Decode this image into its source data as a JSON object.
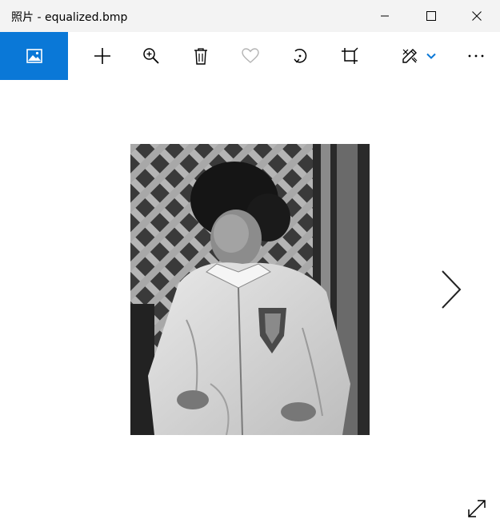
{
  "window": {
    "title": "照片 - equalized.bmp",
    "controls": [
      {
        "name": "minimize-icon"
      },
      {
        "name": "maximize-icon"
      },
      {
        "name": "close-icon"
      }
    ]
  },
  "toolbar": {
    "items": [
      {
        "name": "photo-icon",
        "active": true
      },
      {
        "name": "add-icon"
      },
      {
        "name": "zoom-in-icon"
      },
      {
        "name": "delete-icon"
      },
      {
        "name": "favorite-heart-icon",
        "disabled": true
      },
      {
        "name": "rotate-icon"
      },
      {
        "name": "crop-icon"
      },
      {
        "name": "edit-draw-icon"
      },
      {
        "name": "chevron-down-icon"
      },
      {
        "name": "more-icon"
      }
    ],
    "accent_color": "#0a78d7"
  },
  "viewer": {
    "image_subject": "grayscale photo of a child in a light jacket in front of lattice",
    "next_control": "chevron-right-icon",
    "expand_control": "expand-icon"
  }
}
